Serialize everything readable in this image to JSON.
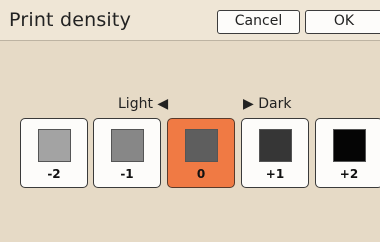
{
  "header": {
    "title": "Print density",
    "cancel_label": "Cancel",
    "ok_label": "OK"
  },
  "hints": {
    "light": "Light ◀",
    "dark": "▶ Dark"
  },
  "density": {
    "selected": "0",
    "options": [
      {
        "label": "-2",
        "swatch_color": "#a3a3a3"
      },
      {
        "label": "-1",
        "swatch_color": "#878787"
      },
      {
        "label": "0",
        "swatch_color": "#5e5e5e"
      },
      {
        "label": "+1",
        "swatch_color": "#363636"
      },
      {
        "label": "+2",
        "swatch_color": "#050505"
      }
    ]
  },
  "colors": {
    "background": "#e6dac6",
    "selected_tile": "#f07a44"
  }
}
